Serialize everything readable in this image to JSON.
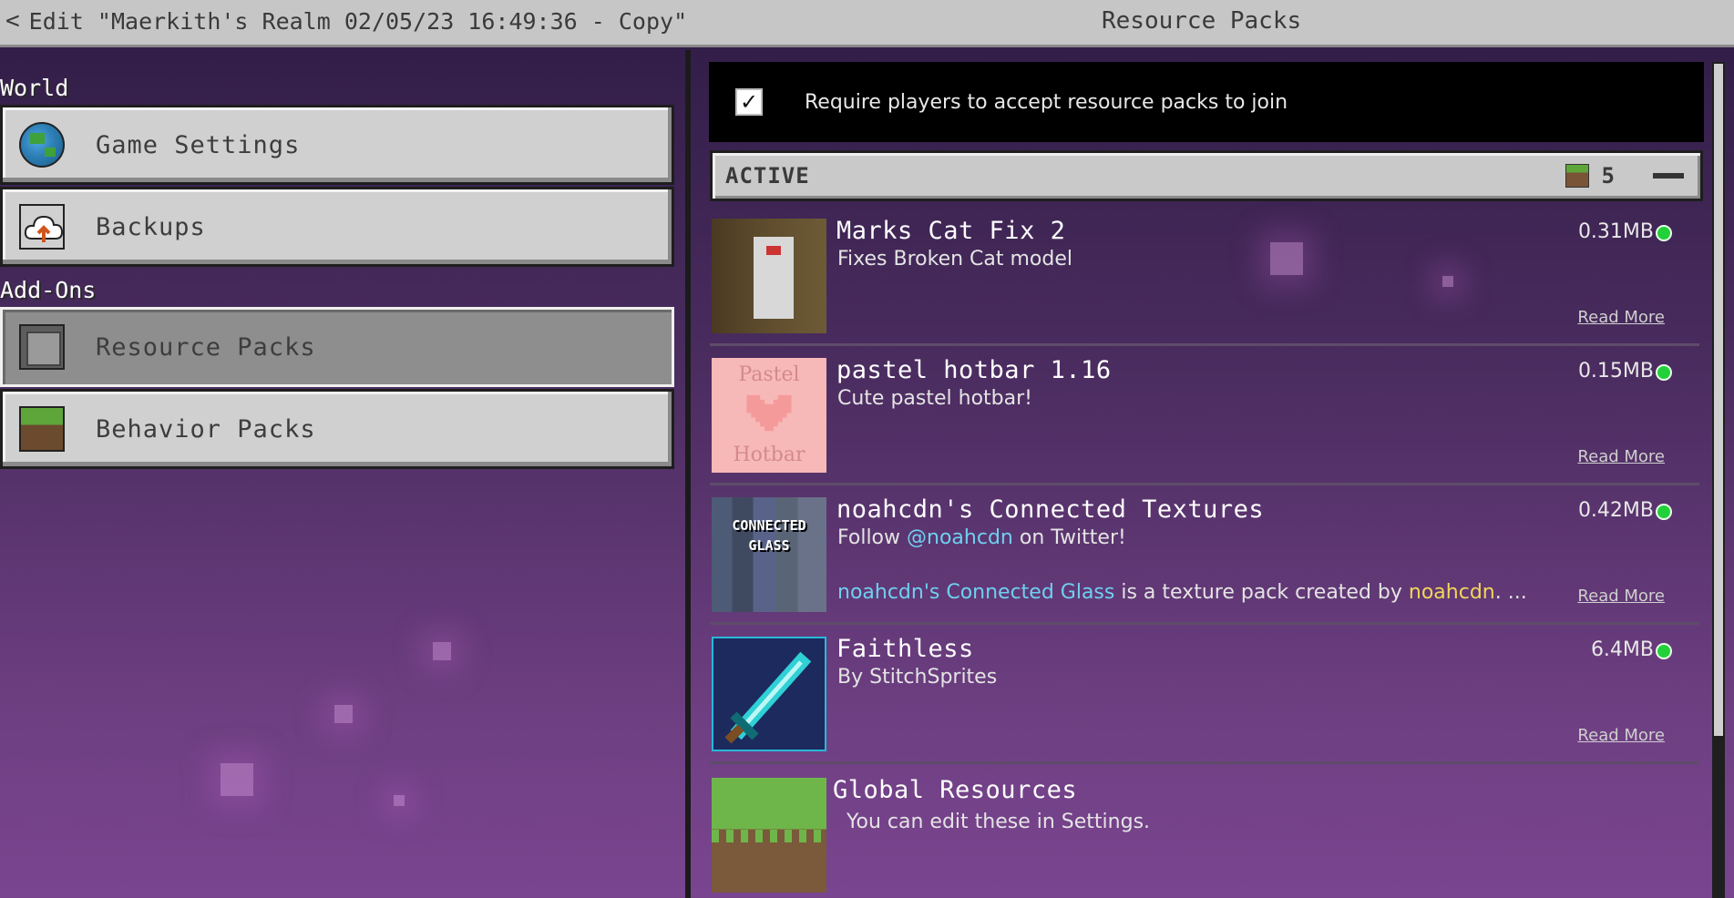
{
  "topbar": {
    "back_label": "Edit \"Maerkith's Realm 02/05/23 16:49:36 - Copy\"",
    "back_icon": "<",
    "title": "Resource Packs"
  },
  "sidebar": {
    "sections": [
      {
        "label": "World",
        "items": [
          {
            "label": "Game Settings",
            "icon": "globe-icon"
          },
          {
            "label": "Backups",
            "icon": "cloud-upload-icon"
          }
        ]
      },
      {
        "label": "Add-Ons",
        "items": [
          {
            "label": "Resource Packs",
            "icon": "resource-pack-icon",
            "selected": true
          },
          {
            "label": "Behavior Packs",
            "icon": "grass-block-icon"
          }
        ]
      }
    ]
  },
  "main": {
    "require_checkbox": {
      "checked": true,
      "check_glyph": "✓",
      "label": "Require players to accept resource packs to join"
    },
    "active_section": {
      "label": "ACTIVE",
      "count": "5",
      "collapse_icon": "minus-icon"
    },
    "packs": [
      {
        "name": "Marks Cat Fix 2",
        "description": "Fixes Broken Cat model",
        "size": "0.31MB",
        "read_more": "Read More"
      },
      {
        "name": "pastel hotbar 1.16",
        "description": "Cute pastel hotbar!",
        "size": "0.15MB",
        "read_more": "Read More",
        "thumb_top": "Pastel",
        "thumb_bottom": "Hotbar"
      },
      {
        "name": "noahcdn's Connected Textures",
        "desc_prefix": "Follow ",
        "desc_handle": "@noahcdn",
        "desc_suffix": " on Twitter!",
        "desc2_name": "noahcdn's Connected Glass",
        "desc2_mid": " is a texture pack created by ",
        "desc2_author": "noahcdn",
        "desc2_end": ".  ...",
        "size": "0.42MB",
        "read_more": "Read More",
        "thumb_line1": "CONNECTED",
        "thumb_line2": "GLASS"
      },
      {
        "name": "Faithless",
        "description": "By StitchSprites",
        "size": "6.4MB",
        "read_more": "Read More"
      },
      {
        "name": "Global Resources",
        "description": "You can edit these in Settings."
      }
    ]
  },
  "colors": {
    "status_active": "#22d13a",
    "highlight_cyan": "#5ee6ee",
    "highlight_gold": "#f2d65a"
  }
}
